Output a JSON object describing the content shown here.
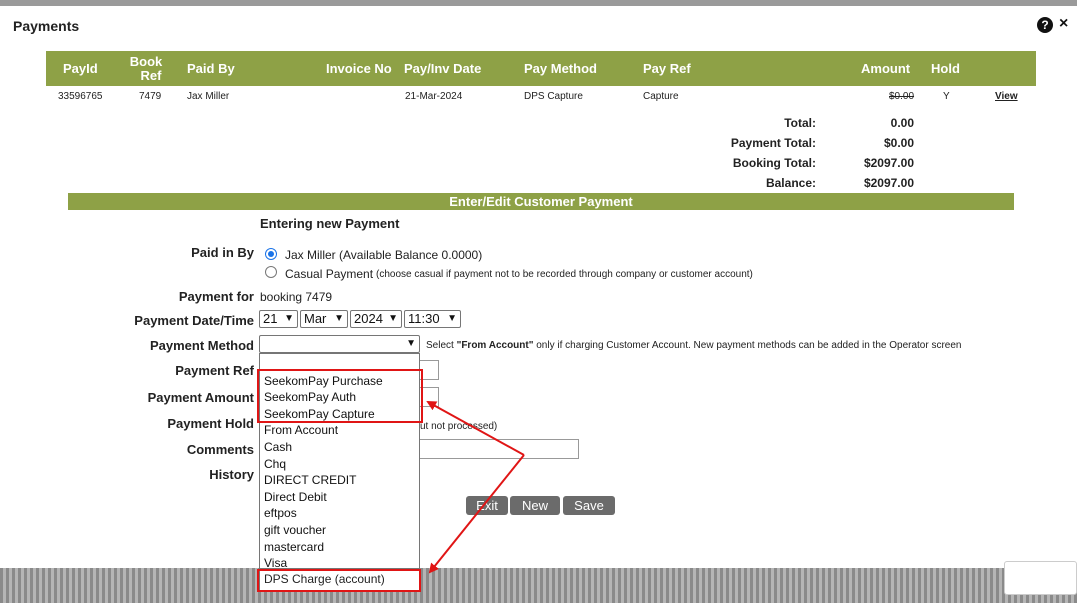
{
  "dialog": {
    "title": "Payments",
    "help_icon": "?",
    "close_icon": "×"
  },
  "table": {
    "headers": {
      "payid": "PayId",
      "book_ref_1": "Book",
      "book_ref_2": "Ref",
      "paid_by": "Paid By",
      "invoice_no": "Invoice No",
      "pay_inv_date": "Pay/Inv Date",
      "pay_method": "Pay Method",
      "pay_ref": "Pay Ref",
      "amount": "Amount",
      "hold": "Hold"
    },
    "row": {
      "payid": "33596765",
      "book_ref": "7479",
      "paid_by": "Jax Miller",
      "pay_inv_date": "21-Mar-2024",
      "pay_method": "DPS Capture",
      "pay_ref": "Capture",
      "amount": "$0.00",
      "hold": "Y",
      "view": "View"
    }
  },
  "summary": {
    "total_label": "Total:",
    "total_value": "0.00",
    "payment_total_label": "Payment Total:",
    "payment_total_value": "$0.00",
    "booking_total_label": "Booking Total:",
    "booking_total_value": "$2097.00",
    "balance_label": "Balance:",
    "balance_value": "$2097.00"
  },
  "form": {
    "section_title": "Enter/Edit Customer Payment",
    "subhead": "Entering new Payment",
    "paid_in_by_label": "Paid in By",
    "option_customer": "Jax Miller (Available Balance 0.0000)",
    "option_casual": "Casual Payment",
    "option_casual_note": "(choose casual if payment not to be recorded through company or customer account)",
    "payment_for_label": "Payment for",
    "payment_for_value": "booking 7479",
    "payment_date_label": "Payment Date/Time",
    "date_day": "21",
    "date_month": "Mar",
    "date_year": "2024",
    "date_time": "11:30",
    "payment_method_label": "Payment Method",
    "payment_method_value": "",
    "method_hint_pre": "Select ",
    "method_hint_bold": "\"From Account\"",
    "method_hint_post": " only if charging Customer Account.  New payment methods can be added in the Operator screen",
    "payment_ref_label": "Payment Ref",
    "payment_amount_label": "Payment Amount",
    "payment_hold_label": "Payment Hold",
    "payment_hold_note_fragment": "ut not processed)",
    "comments_label": "Comments",
    "history_label": "History"
  },
  "dropdown_options": [
    "SeekomPay Purchase",
    "SeekomPay Auth",
    "SeekomPay Capture",
    "From Account",
    "Cash",
    "Chq",
    "DIRECT CREDIT",
    "Direct Debit",
    "eftpos",
    "gift voucher",
    "mastercard",
    "Visa",
    "DPS Charge (account)"
  ],
  "buttons": {
    "exit": "Exit",
    "new": "New",
    "save": "Save"
  },
  "colors": {
    "header_green": "#8ea146",
    "highlight_red": "#e01515",
    "radio_blue": "#1a73e8"
  }
}
